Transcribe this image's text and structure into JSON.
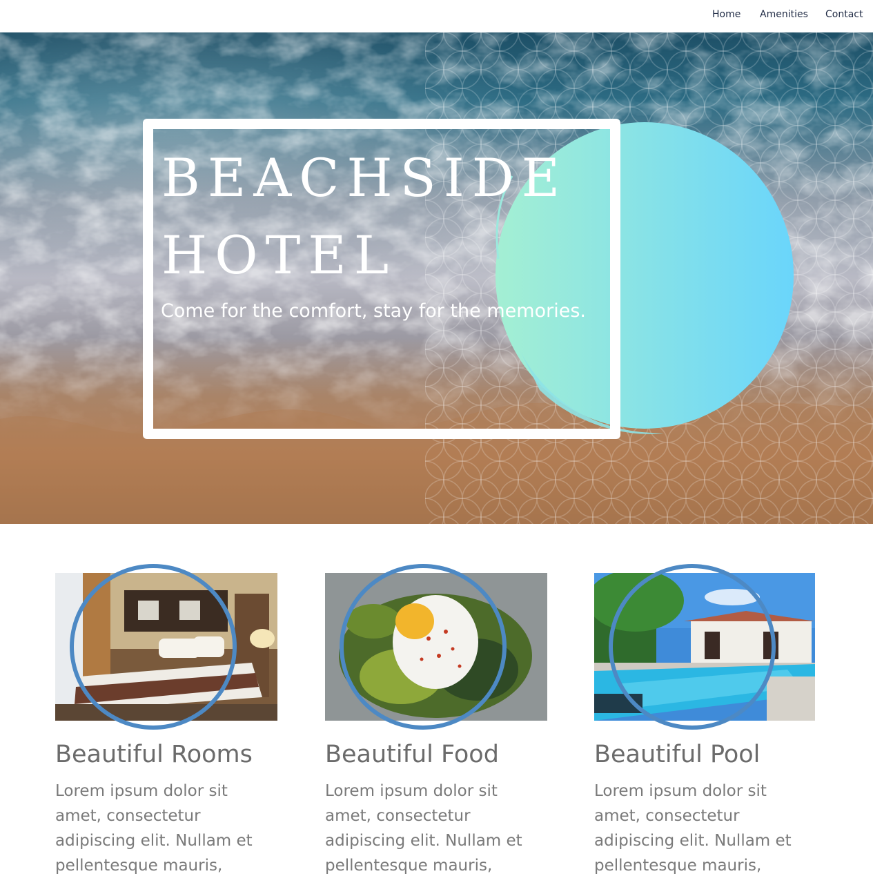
{
  "nav": {
    "links": [
      "Home",
      "Amenities",
      "Contact"
    ]
  },
  "hero": {
    "title_line1": "BEACHSIDE",
    "title_line2": "HOTEL",
    "tagline": "Come for the comfort, stay for the memories."
  },
  "features": [
    {
      "title": "Beautiful Rooms",
      "text": "Lorem ipsum dolor sit amet, consectetur adipiscing elit. Nullam et pellentesque mauris,",
      "image": "hotel-room-photo"
    },
    {
      "title": "Beautiful Food",
      "text": "Lorem ipsum dolor sit amet, consectetur adipiscing elit. Nullam et pellentesque mauris,",
      "image": "poached-egg-toast-photo"
    },
    {
      "title": "Beautiful Pool",
      "text": "Lorem ipsum dolor sit amet, consectetur adipiscing elit. Nullam et pellentesque mauris,",
      "image": "pool-villa-photo"
    }
  ],
  "colors": {
    "ring": "#4d89c4",
    "heading": "#6b6b6b",
    "nav_text": "#1f2a44",
    "circle_gradient_start": "#a4efd3",
    "circle_gradient_end": "#6ad5fb"
  }
}
